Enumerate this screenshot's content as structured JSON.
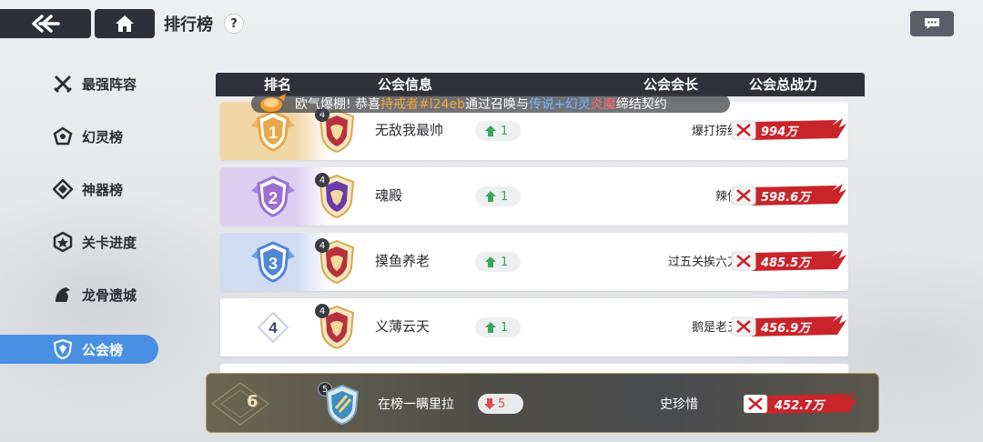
{
  "header": {
    "back_icon": "double-chevron-left-icon",
    "home_icon": "home-icon",
    "title": "排行榜",
    "help_label": "?",
    "chat_icon": "chat-bubble-icon"
  },
  "sidebar": {
    "items": [
      {
        "label": "最强阵容",
        "icon": "crossed-swords-icon",
        "active": false
      },
      {
        "label": "幻灵榜",
        "icon": "spirit-icon",
        "active": false
      },
      {
        "label": "神器榜",
        "icon": "artifact-icon",
        "active": false
      },
      {
        "label": "关卡进度",
        "icon": "stage-icon",
        "active": false
      },
      {
        "label": "龙骨遗城",
        "icon": "dragon-icon",
        "active": false
      },
      {
        "label": "公会榜",
        "icon": "guild-shield-icon",
        "active": true
      }
    ]
  },
  "table": {
    "headers": {
      "rank": "排名",
      "guild_info": "公会信息",
      "leader": "公会会长",
      "power": "公会总战力"
    },
    "rows": [
      {
        "rank": "1",
        "level": "4",
        "name": "无敌我最帅",
        "trend": "1",
        "trend_dir": "up",
        "leader": "爆打捞纪",
        "power": "994万",
        "rank_color": "#f1d7a6"
      },
      {
        "rank": "2",
        "level": "4",
        "name": "魂殿",
        "trend": "1",
        "trend_dir": "up",
        "leader": "辣仔",
        "power": "598.6万",
        "rank_color": "#dccff2"
      },
      {
        "rank": "3",
        "level": "4",
        "name": "摸鱼养老",
        "trend": "1",
        "trend_dir": "up",
        "leader": "过五关挨六刀",
        "power": "485.5万",
        "rank_color": "#cfdcf3"
      },
      {
        "rank": "4",
        "level": "4",
        "name": "义薄云天",
        "trend": "1",
        "trend_dir": "up",
        "leader": "鹅是老五",
        "power": "456.9万",
        "rank_color": "#ffffff"
      }
    ]
  },
  "ticker": {
    "prefix": "欧气爆棚!  恭喜",
    "player": "持戒者#l24eb",
    "mid": "通过召唤与",
    "rarity": "传说",
    "plus": "+幻灵",
    "spirit": "炎魔",
    "suffix": "缔结契约"
  },
  "self": {
    "rank": "6",
    "level": "5",
    "name": "在榜一瞒里拉",
    "trend": "5",
    "trend_dir": "down",
    "leader": "史珍惜",
    "power": "452.7万"
  },
  "colors": {
    "accent": "#4a90e2",
    "trend_up": "#3aa85a",
    "trend_down": "#e04a4a",
    "power_red": "#c8242a"
  }
}
